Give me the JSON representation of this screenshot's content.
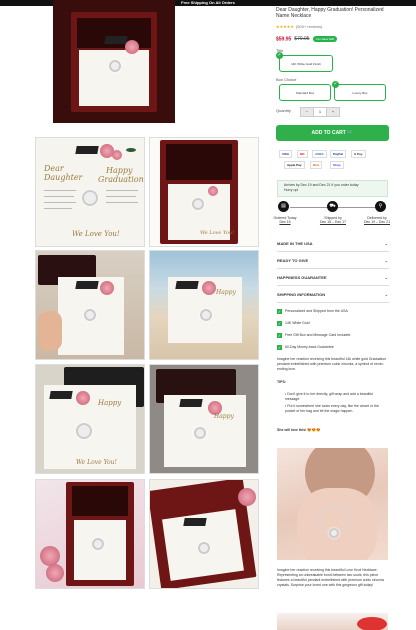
{
  "topbar": {
    "text": "Free Shipping On All Orders"
  },
  "product": {
    "title": "Dear Daughter, Happy Graduation! Personalized Name Necklace",
    "stars": "★★★★★",
    "rating_text": "(4 from 4,9)",
    "reviews_hint": "(500+ reviews)",
    "price_now": "$59.95",
    "price_old": "$79.95",
    "save_badge": "You Save $20"
  },
  "options": {
    "title_label": "Title",
    "title_value": "14K White Gold Finish",
    "box_label": "Box Choice",
    "box_a": "Standard Box",
    "box_b": "Luxury Box",
    "qty_label": "Quantity",
    "qty_minus": "−",
    "qty_value": "1",
    "qty_plus": "+",
    "cart_button": "ADD TO CART"
  },
  "payments": [
    "VISA",
    "MC",
    "AMEX",
    "PayPal",
    "G Pay",
    "Apple Pay",
    "Disc",
    "Shop"
  ],
  "delivery": {
    "line1": "Arrives by Dec 19 and Dec 21 if you order today",
    "line2": "Hurry up!",
    "steps": [
      {
        "icon": "cart-icon",
        "title": "Ordered Today",
        "date": "Dec 15"
      },
      {
        "icon": "truck-icon",
        "title": "Shipped by",
        "date": "Dec 16 – Dec 17"
      },
      {
        "icon": "pin-icon",
        "title": "Delivered by",
        "date": "Dec 19 – Dec 21"
      }
    ]
  },
  "accordions": [
    "MADE IN THE USA",
    "READY TO GIVE",
    "HAPPINESS GUARANTEE",
    "SHIPPING INFORMATION"
  ],
  "features": [
    "Personalized and Shipped from the USA",
    "14K White Gold",
    "Free Gift Box and Message Card Included",
    "60-Day Money-back Guarantee"
  ],
  "description": {
    "intro": "Imagine her reaction receiving this beautiful 14k white gold Graduation pendant embellished with premium cubic zirconia, a symbol of never-ending love.",
    "tips_label": "TIPS:",
    "tip1": "Don't give it to her directly, gift wrap and add a beautiful message.",
    "tip2": "Put it somewhere she looks every day, like the closet or the pocket of her bag and let the magic happen.",
    "closing": "She will love this! 😍😍😍",
    "para2": "Imagine her reaction receiving this beautiful Love Knot Necklace. Representing an unbreakable bond between two souls, this piece features a beautiful pendant embellished with premium cubic zirconia crystals. Surprise your loved one with this gorgeous gift today!"
  },
  "cards": {
    "dear": "Dear",
    "daughter": "Daughter",
    "happy": "Happy",
    "graduation": "Graduation!",
    "love": "We Love You!"
  }
}
